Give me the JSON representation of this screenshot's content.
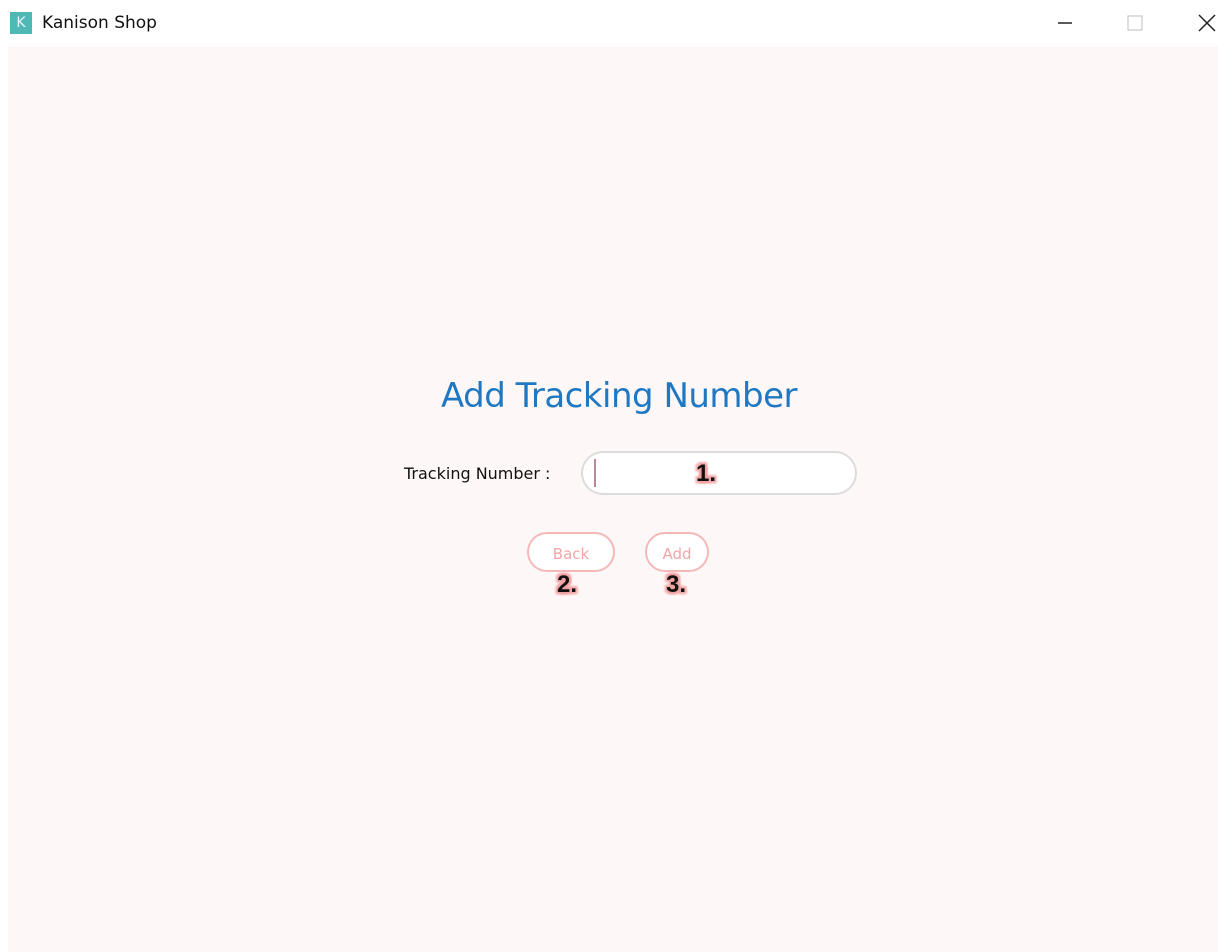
{
  "window": {
    "app_icon_letter": "K",
    "title": "Kanison Shop"
  },
  "page": {
    "heading": "Add Tracking Number",
    "tracking_label": "Tracking Number :",
    "tracking_value": "",
    "tracking_placeholder": ""
  },
  "buttons": {
    "back_label": "Back",
    "add_label": "Add"
  },
  "annotations": {
    "marker_1": "1.",
    "marker_2": "2.",
    "marker_3": "3."
  },
  "icons": {
    "app": "app-logo-icon",
    "minimize": "minimize-icon",
    "maximize": "maximize-icon",
    "close": "close-icon"
  },
  "colors": {
    "heading": "#1f78c1",
    "button_border": "#f5b8b8",
    "button_text": "#f0a6a6",
    "app_icon": "#4fb8b5",
    "content_bg": "#fdf8f7"
  }
}
